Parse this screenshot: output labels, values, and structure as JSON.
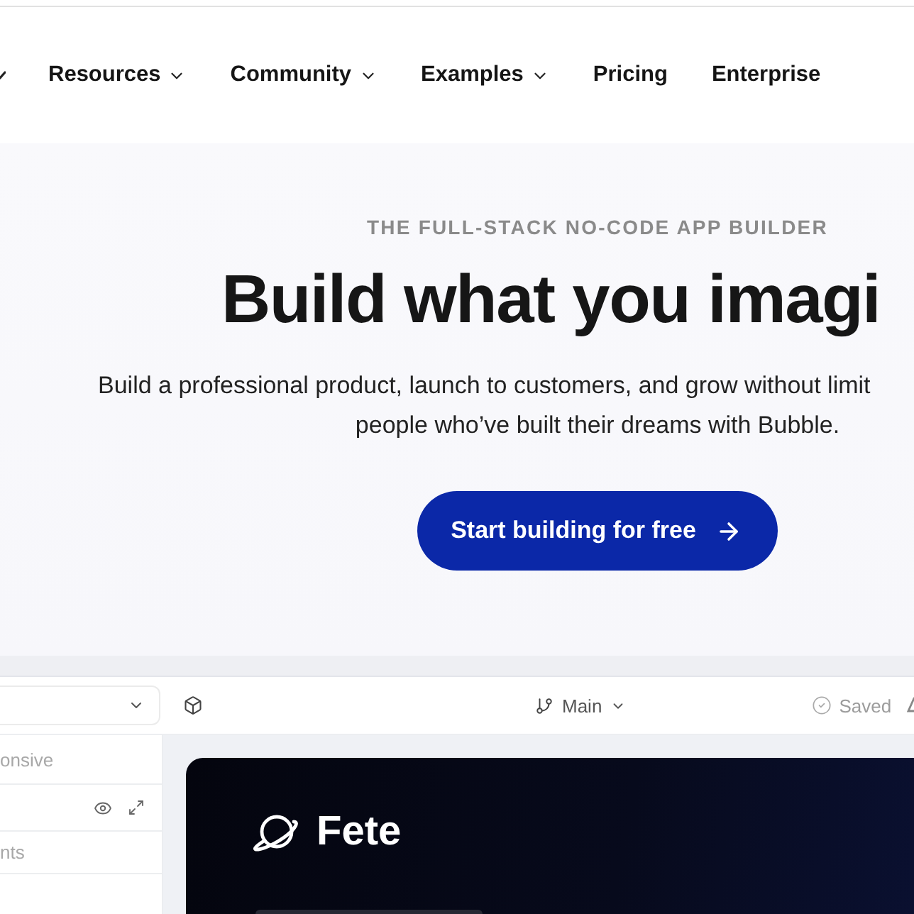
{
  "nav": {
    "items": [
      {
        "kind": "menu",
        "label": "Resources"
      },
      {
        "kind": "menu",
        "label": "Community"
      },
      {
        "kind": "menu",
        "label": "Examples"
      },
      {
        "kind": "link",
        "label": "Pricing"
      },
      {
        "kind": "link",
        "label": "Enterprise"
      }
    ]
  },
  "hero": {
    "eyebrow": "THE FULL-STACK NO-CODE APP BUILDER",
    "title": "Build what you imagi",
    "description_lines": [
      "Build a professional product, launch to customers, and grow without limit",
      "people who’ve built their dreams with Bubble."
    ],
    "cta": {
      "label": "Start building for free"
    }
  },
  "editor": {
    "toolbar": {
      "branch": "Main",
      "status": "Saved"
    },
    "sidebar": {
      "rows": [
        {
          "kind": "label",
          "label": "onsive"
        },
        {
          "kind": "icons"
        },
        {
          "kind": "label",
          "label": "nts"
        }
      ]
    },
    "canvas": {
      "app_name": "Fete"
    }
  }
}
